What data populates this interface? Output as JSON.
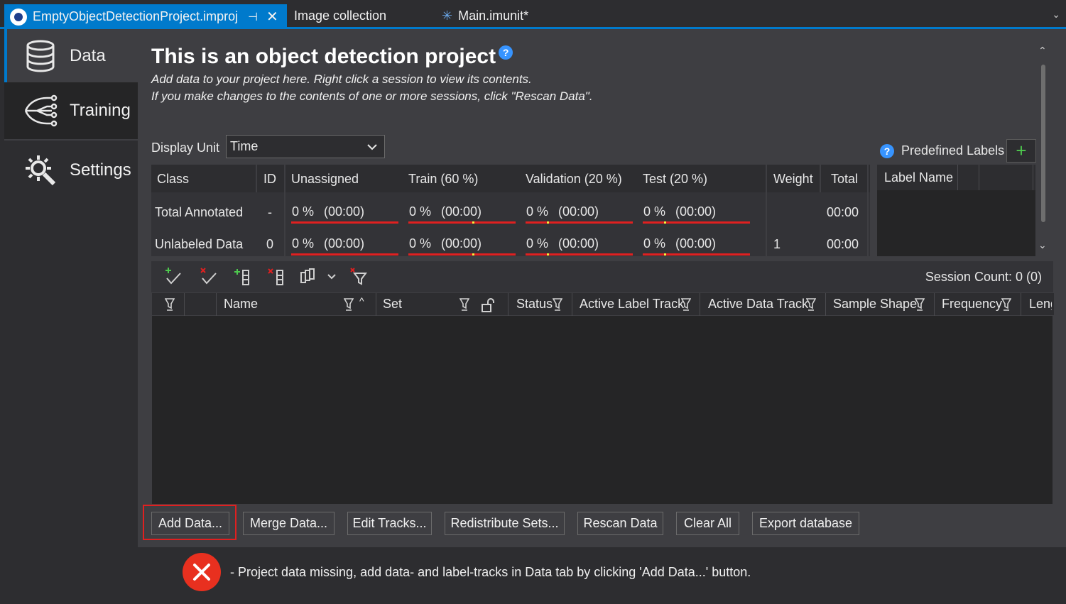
{
  "tabs": [
    {
      "label": "EmptyObjectDetectionProject.improj",
      "active": true
    },
    {
      "label": "Image collection",
      "active": false
    },
    {
      "label": "Main.imunit*",
      "active": false
    }
  ],
  "nav": {
    "data": "Data",
    "training": "Training",
    "settings": "Settings"
  },
  "header": {
    "title": "This is an object detection project",
    "help": "?",
    "line1": "Add data to your project here. Right click a session to view its contents.",
    "line2": "If you make changes to the contents of one or more sessions, click \"Rescan Data\"."
  },
  "display_unit": {
    "label": "Display Unit",
    "value": "Time"
  },
  "class_table": {
    "columns": [
      "Class",
      "ID",
      "Unassigned",
      "Train (60 %)",
      "Validation (20 %)",
      "Test (20 %)",
      "Weight",
      "Total"
    ],
    "rows": [
      {
        "class": "Total Annotated",
        "id": "-",
        "unassigned_pct": "0 %",
        "unassigned_time": "(00:00)",
        "train_pct": "0 %",
        "train_time": "(00:00)",
        "val_pct": "0 %",
        "val_time": "(00:00)",
        "test_pct": "0 %",
        "test_time": "(00:00)",
        "weight": "",
        "total": "00:00"
      },
      {
        "class": "Unlabeled Data",
        "id": "0",
        "unassigned_pct": "0 %",
        "unassigned_time": "(00:00)",
        "train_pct": "0 %",
        "train_time": "(00:00)",
        "val_pct": "0 %",
        "val_time": "(00:00)",
        "test_pct": "0 %",
        "test_time": "(00:00)",
        "weight": "1",
        "total": "00:00"
      }
    ]
  },
  "predefined_labels": {
    "label": "Predefined Labels",
    "add": "+",
    "column": "Label Name"
  },
  "sessions": {
    "count_label": "Session Count: 0 (0)",
    "columns": [
      "Name",
      "Set",
      "Status",
      "Active Label Track",
      "Active Data Track",
      "Sample Shape",
      "Frequency",
      "Leng"
    ]
  },
  "buttons": {
    "add_data": "Add Data...",
    "merge_data": "Merge Data...",
    "edit_tracks": "Edit Tracks...",
    "redistribute": "Redistribute Sets...",
    "rescan": "Rescan Data",
    "clear_all": "Clear All",
    "export": "Export database"
  },
  "status": {
    "message": "- Project data missing, add data- and label-tracks in Data tab by clicking 'Add Data...' button."
  },
  "colors": {
    "accent": "#007acc",
    "error": "#e8301f",
    "bar": "#e02020",
    "marker": "#ffeb3b",
    "add_green": "#4ec94e"
  }
}
